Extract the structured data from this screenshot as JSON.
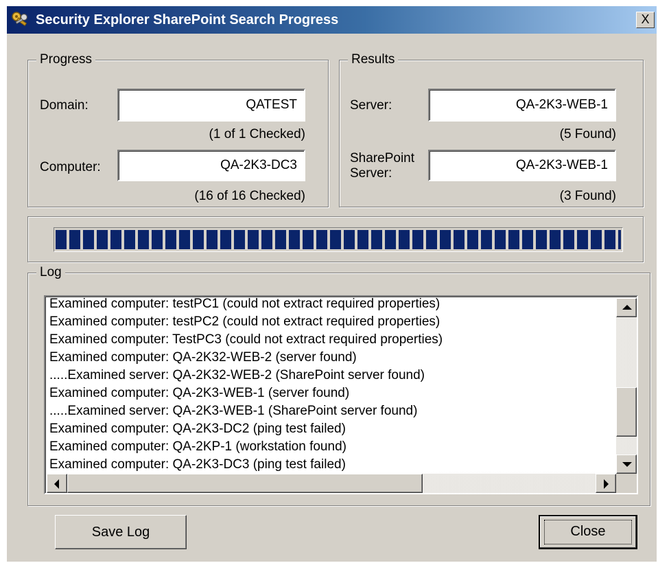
{
  "window": {
    "title": "Security Explorer SharePoint Search Progress",
    "close_glyph": "X"
  },
  "progress": {
    "legend": "Progress",
    "domain_label": "Domain:",
    "domain_value": "QATEST",
    "domain_checked": "(1 of 1 Checked)",
    "computer_label": "Computer:",
    "computer_value": "QA-2K3-DC3",
    "computer_checked": "(16 of 16 Checked)"
  },
  "results": {
    "legend": "Results",
    "server_label": "Server:",
    "server_value": "QA-2K3-WEB-1",
    "server_found": "(5 Found)",
    "sp_label_line1": "SharePoint",
    "sp_label_line2": "Server:",
    "sp_value": "QA-2K3-WEB-1",
    "sp_found": "(3 Found)"
  },
  "progress_bar": {
    "fraction": 1.0
  },
  "log": {
    "legend": "Log",
    "lines": [
      "Examined computer: testPC1 (could not extract required properties)",
      "Examined computer: testPC2 (could not extract required properties)",
      "Examined computer: TestPC3 (could not extract required properties)",
      "Examined computer: QA-2K32-WEB-2 (server found)",
      ".....Examined server: QA-2K32-WEB-2 (SharePoint server found)",
      "Examined computer: QA-2K3-WEB-1 (server found)",
      ".....Examined server: QA-2K3-WEB-1 (SharePoint server found)",
      "Examined computer: QA-2K3-DC2 (ping test failed)",
      "Examined computer: QA-2KP-1 (workstation found)",
      "Examined computer: QA-2K3-DC3 (ping test failed)"
    ]
  },
  "buttons": {
    "save_log": "Save Log",
    "close": "Close"
  },
  "icons": {
    "app": "keys-icon",
    "scroll_up": "arrow-up-icon",
    "scroll_down": "arrow-down-icon",
    "scroll_left": "arrow-left-icon",
    "scroll_right": "arrow-right-icon"
  },
  "colors": {
    "title_start": "#0a246a",
    "title_end": "#a6caf0",
    "progress_fill": "#0a246a",
    "window_face": "#d4d0c8"
  }
}
